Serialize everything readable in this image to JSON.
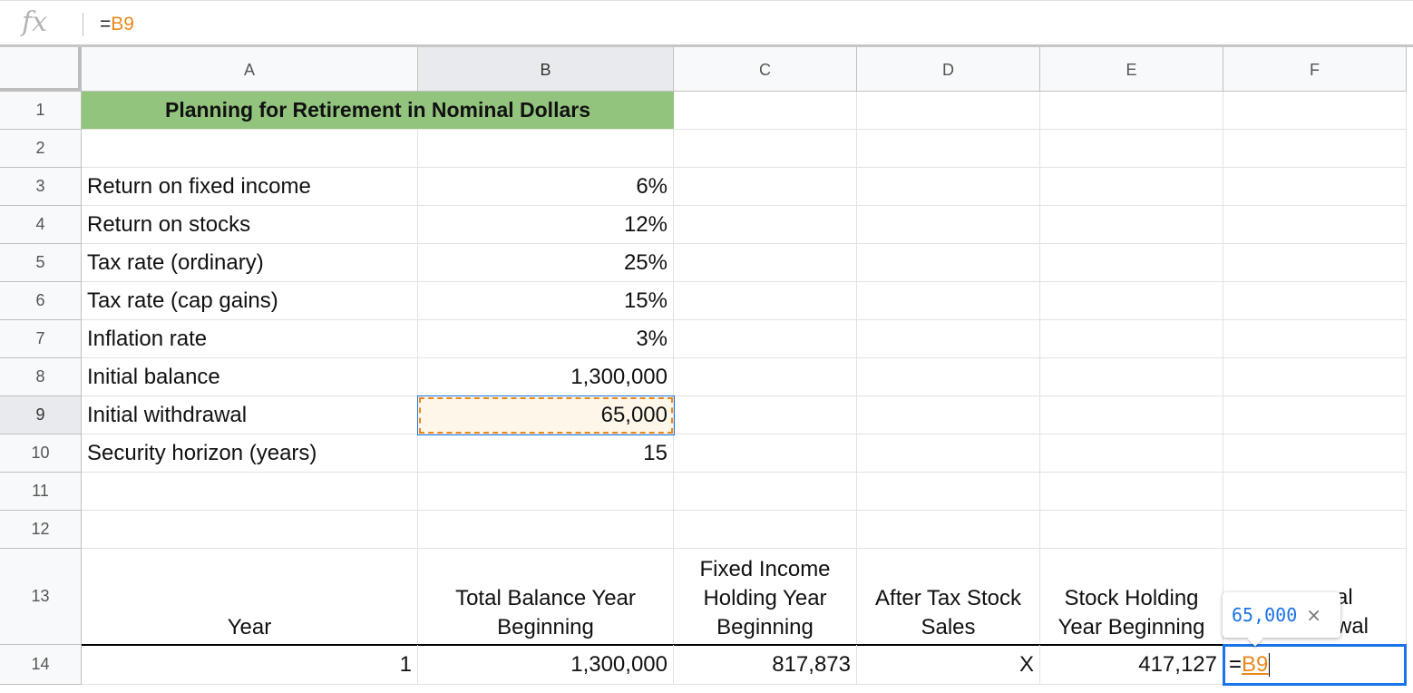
{
  "formula_bar": {
    "fx_label": "fx",
    "eq": "=",
    "ref": "B9"
  },
  "columns": [
    "A",
    "B",
    "C",
    "D",
    "E",
    "F"
  ],
  "rows": [
    "1",
    "2",
    "3",
    "4",
    "5",
    "6",
    "7",
    "8",
    "9",
    "10",
    "11",
    "12",
    "13",
    "14"
  ],
  "title": "Planning for Retirement in Nominal Dollars",
  "params": [
    {
      "label": "Return on fixed income",
      "value": "6%"
    },
    {
      "label": "Return on stocks",
      "value": "12%"
    },
    {
      "label": "Tax rate (ordinary)",
      "value": "25%"
    },
    {
      "label": "Tax rate (cap gains)",
      "value": "15%"
    },
    {
      "label": "Inflation rate",
      "value": "3%"
    },
    {
      "label": "Initial balance",
      "value": "1,300,000"
    },
    {
      "label": "Initial withdrawal",
      "value": "65,000"
    },
    {
      "label": "Security horizon (years)",
      "value": "15"
    }
  ],
  "headers": {
    "a": "Year",
    "b": "Total Balance Year Beginning",
    "c": "Fixed Income Holding Year Beginning",
    "d": "After Tax Stock Sales",
    "e": "Stock Holding Year Beginning",
    "f_visible_tail_line1": "al",
    "f_visible_tail_line2": "wal"
  },
  "row14": {
    "a": "1",
    "b": "1,300,000",
    "c": "817,873",
    "d": "X",
    "e": "417,127"
  },
  "active_cell": {
    "eq": "=",
    "ref": "B9"
  },
  "tooltip": {
    "value": "65,000",
    "close": "×"
  },
  "colors": {
    "title_bg": "#93c47d",
    "ref_orange": "#e8891a",
    "select_blue": "#1a73e8"
  }
}
